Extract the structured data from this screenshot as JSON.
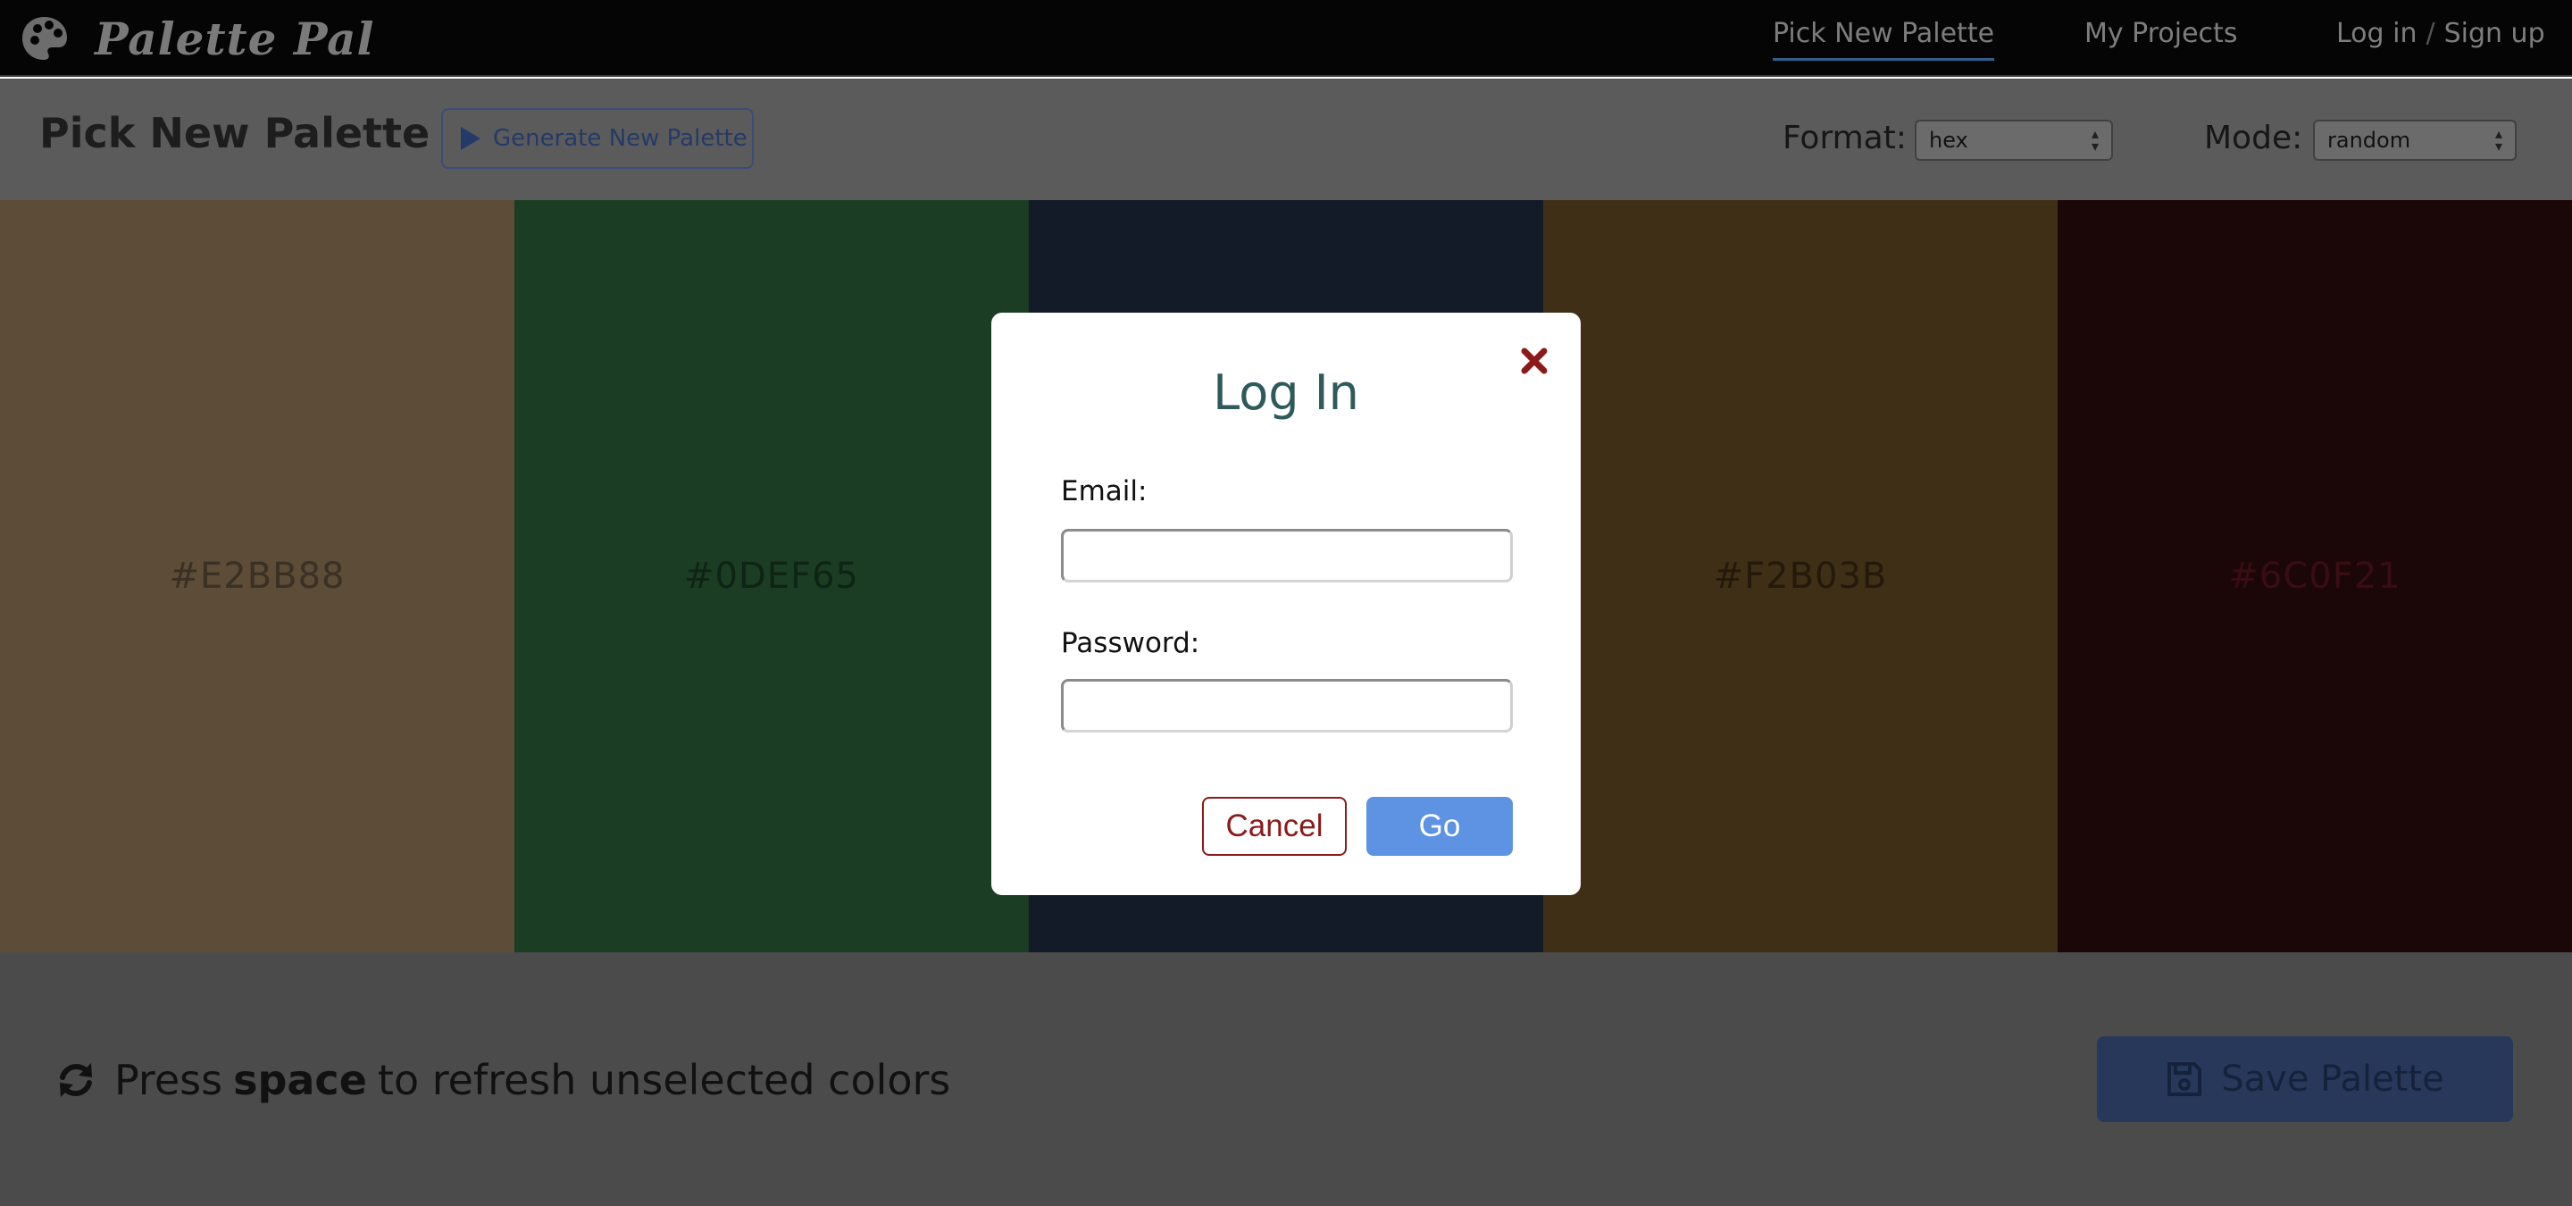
{
  "app": {
    "brand_name": "Palette Pal",
    "logo_icon": "palette-icon"
  },
  "nav": {
    "items": [
      {
        "label": "Pick New Palette",
        "active": true
      },
      {
        "label": "My Projects",
        "active": false
      }
    ],
    "login_label": "Log in",
    "separator": "/",
    "signup_label": "Sign up"
  },
  "toolbar": {
    "title": "Pick New Palette",
    "generate_label": "Generate New Palette",
    "generate_icon": "play-icon",
    "format_label": "Format:",
    "format_value": "hex",
    "mode_label": "Mode:",
    "mode_value": "random"
  },
  "swatches": [
    {
      "hex": "#E2BB88",
      "dimmed_color": "#5d4d38",
      "text_color": "#3a3024"
    },
    {
      "hex": "#0DEF65",
      "dimmed_color": "#1b3d24",
      "text_color": "#0e2414"
    },
    {
      "hex": "",
      "dimmed_color": "#131a28",
      "text_color": "#0b0f17"
    },
    {
      "hex": "#F2B03B",
      "dimmed_color": "#3f2f16",
      "text_color": "#24190a"
    },
    {
      "hex": "#6C0F21",
      "dimmed_color": "#1b0707",
      "text_color": "#3a0c14"
    }
  ],
  "footer": {
    "hint_pre": "Press",
    "hint_key": "space",
    "hint_post": "to refresh unselected colors",
    "refresh_icon": "refresh-icon",
    "save_label": "Save Palette",
    "save_icon": "floppy-disk-icon"
  },
  "modal": {
    "title": "Log In",
    "email_label": "Email:",
    "email_value": "",
    "password_label": "Password:",
    "password_value": "",
    "cancel_label": "Cancel",
    "go_label": "Go",
    "close_icon": "close-icon",
    "colors": {
      "title": "#2f5a5c",
      "close": "#8b1a1a",
      "go": "#5e92e3"
    }
  }
}
